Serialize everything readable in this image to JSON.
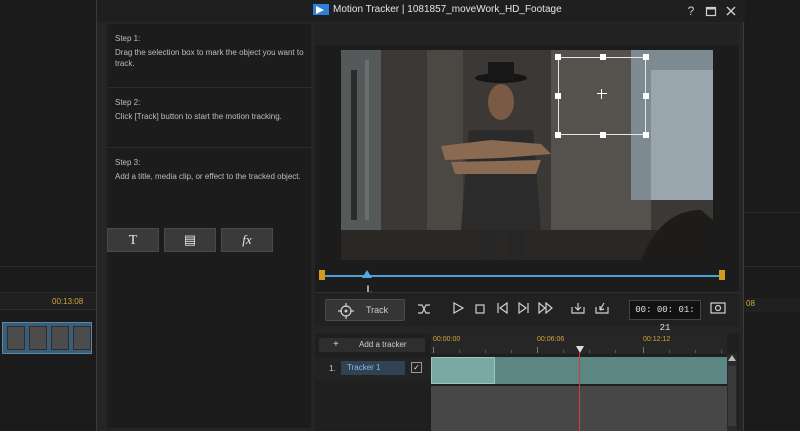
{
  "window": {
    "title": "Motion Tracker | 1081857_moveWork_HD_Footage",
    "help_icon": "?",
    "restore_icon": "restore-icon",
    "close_icon": "close-icon"
  },
  "background": {
    "left_ruler_time": "00:13:08",
    "right_ruler_time": "08"
  },
  "steps": [
    {
      "heading": "Step 1:",
      "text": "Drag the selection box to mark the object you want to track."
    },
    {
      "heading": "Step 2:",
      "text": "Click [Track] button to start the motion tracking."
    },
    {
      "heading": "Step 3:",
      "text": "Add a title, media clip, or effect to the tracked object."
    }
  ],
  "tools": [
    {
      "name": "title-icon",
      "glyph": "T"
    },
    {
      "name": "media-icon",
      "glyph": "▤"
    },
    {
      "name": "effect-icon",
      "glyph": "fx"
    }
  ],
  "controls": {
    "track_label": "Track",
    "timecode": "00: 00: 01: 21"
  },
  "timeline": {
    "add_tracker_label": "Add a tracker",
    "ruler": [
      "00:00:00",
      "00:06:06",
      "00:12:12"
    ],
    "row_number": "1.",
    "tracker_name": "Tracker 1",
    "tracker_enabled": true
  },
  "colors": {
    "accent_blue": "#4aa2d6",
    "timecode_orange": "#d4a53a",
    "playhead_red": "#d63b3b",
    "tracker_teal": "#5c8684"
  }
}
